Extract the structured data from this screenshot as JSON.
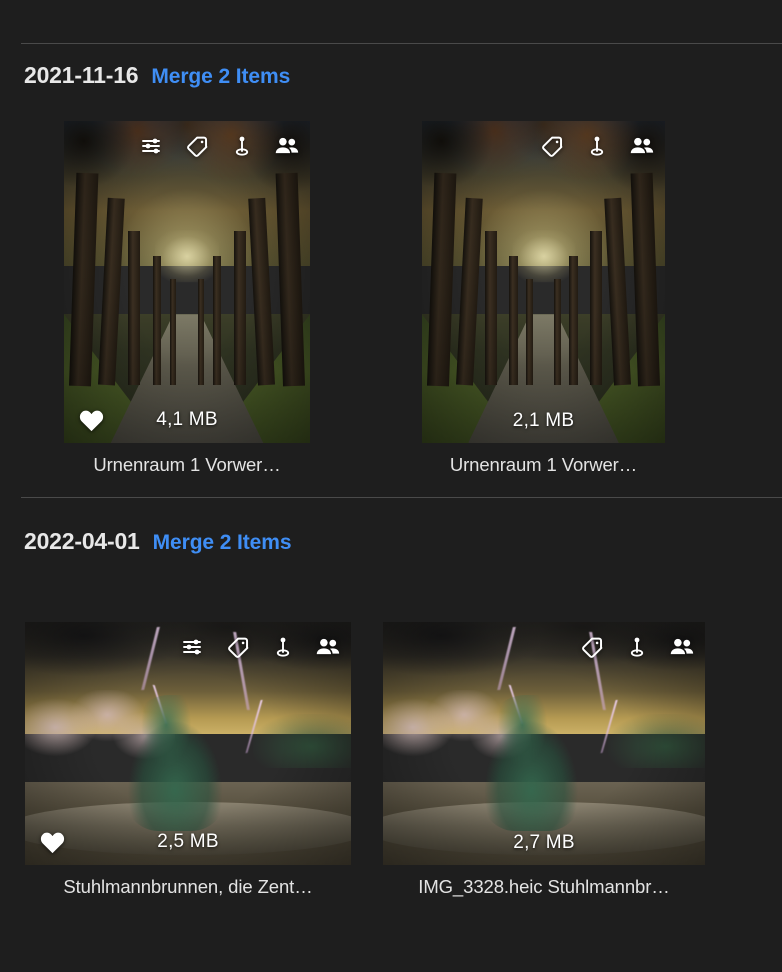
{
  "theme": {
    "background": "#1e1e1e",
    "divider": "#4a4a4a",
    "accent_link": "#3f8ef5",
    "date_text": "#e8e8e8",
    "caption_text": "#e3e3e3",
    "overlay_text": "#ffffff"
  },
  "groups": [
    {
      "date": "2021-11-16",
      "merge_label": "Merge 2 Items",
      "items": [
        {
          "caption": "Urnenraum 1 Vorwer…",
          "size": "4,1 MB",
          "favorite": true,
          "icons": [
            "sliders-icon",
            "tag-icon",
            "location-pin-icon",
            "people-icon"
          ]
        },
        {
          "caption": "Urnenraum 1 Vorwer…",
          "size": "2,1 MB",
          "favorite": false,
          "icons": [
            "tag-icon",
            "location-pin-icon",
            "people-icon"
          ]
        }
      ]
    },
    {
      "date": "2022-04-01",
      "merge_label": "Merge 2 Items",
      "items": [
        {
          "caption": "Stuhlmannbrunnen, die Zent…",
          "size": "2,5 MB",
          "favorite": true,
          "icons": [
            "sliders-icon",
            "tag-icon",
            "location-pin-icon",
            "people-icon"
          ]
        },
        {
          "caption": "IMG_3328.heic Stuhlmannbr…",
          "size": "2,7 MB",
          "favorite": false,
          "icons": [
            "tag-icon",
            "location-pin-icon",
            "people-icon"
          ]
        }
      ]
    }
  ]
}
